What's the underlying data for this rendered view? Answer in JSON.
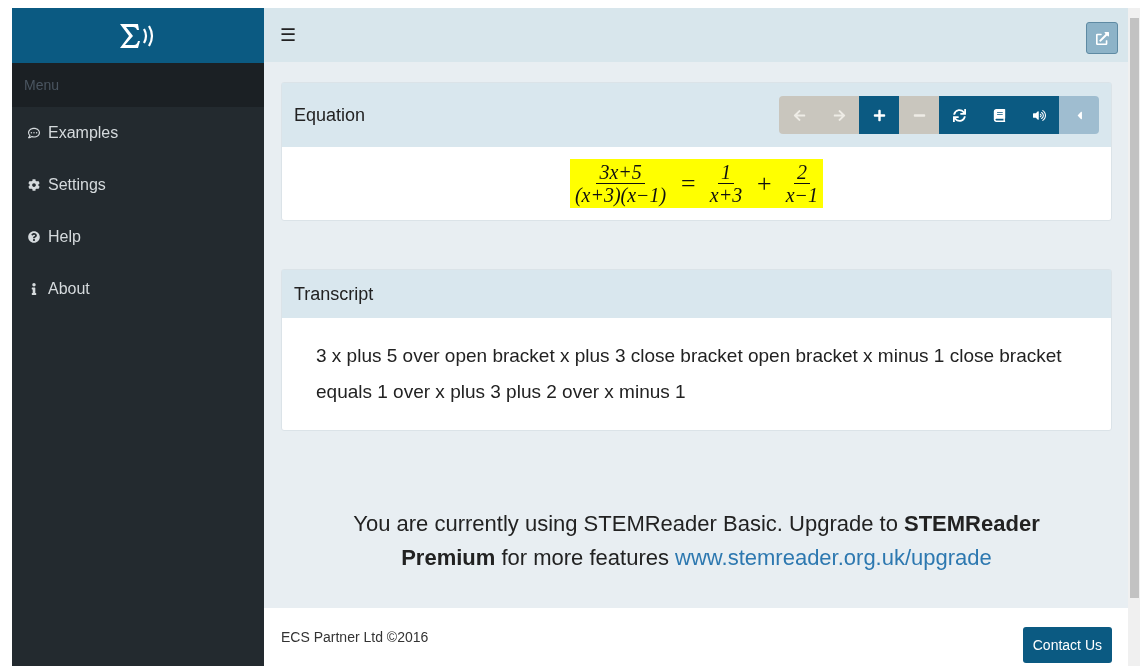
{
  "sidebar": {
    "menu_heading": "Menu",
    "items": [
      {
        "label": "Examples"
      },
      {
        "label": "Settings"
      },
      {
        "label": "Help"
      },
      {
        "label": "About"
      }
    ]
  },
  "topbar": {
    "menu_glyph": "☰"
  },
  "equation_panel": {
    "title": "Equation",
    "toolbar": [
      {
        "disabled": true,
        "kind": "action"
      },
      {
        "disabled": true,
        "kind": "action"
      },
      {
        "disabled": false,
        "kind": "action"
      },
      {
        "disabled": true,
        "kind": "action"
      },
      {
        "disabled": false,
        "kind": "action"
      },
      {
        "disabled": false,
        "kind": "action"
      },
      {
        "disabled": false,
        "kind": "action"
      },
      {
        "disabled": false,
        "kind": "toggle"
      }
    ],
    "equation": {
      "lhs": {
        "numerator": "3x+5",
        "denominator": "(x+3)(x−1)"
      },
      "operator": "=",
      "rhs": [
        {
          "numerator": "1",
          "denominator": "x+3"
        },
        {
          "operator": "+"
        },
        {
          "numerator": "2",
          "denominator": "x−1"
        }
      ]
    }
  },
  "transcript_panel": {
    "title": "Transcript",
    "text": "3 x plus 5 over open bracket x plus 3 close bracket open bracket x minus 1 close bracket equals 1 over x plus 3 plus 2 over x minus 1"
  },
  "upgrade_notice": {
    "text": "You are currently using STEMReader Basic. Upgrade to **STEMReader Premium** for more features",
    "link": "www.stemreader.org.uk/upgrade"
  },
  "footer": {
    "copyright": "ECS Partner Ltd ©2016",
    "button": "Contact Us"
  }
}
